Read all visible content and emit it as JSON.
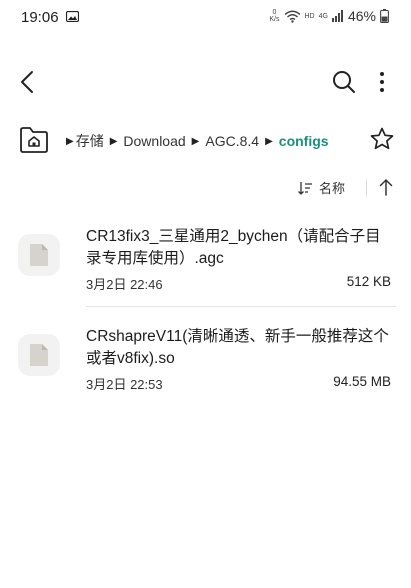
{
  "status": {
    "time": "19:06",
    "speed_top": "0",
    "speed_unit": "K/s",
    "hd": "HD",
    "net": "4G",
    "battery": "46%"
  },
  "breadcrumb": {
    "items": [
      "存储",
      "Download",
      "AGC.8.4"
    ],
    "current": "configs"
  },
  "sort": {
    "label": "名称"
  },
  "files": [
    {
      "name": "CR13fix3_三星通用2_bychen（请配合子目录专用库使用）.agc",
      "date": "3月2日 22:46",
      "size": "512 KB"
    },
    {
      "name": "CRshapreV11(清晰通透、新手一般推荐这个或者v8fix).so",
      "date": "3月2日 22:53",
      "size": "94.55 MB"
    }
  ]
}
